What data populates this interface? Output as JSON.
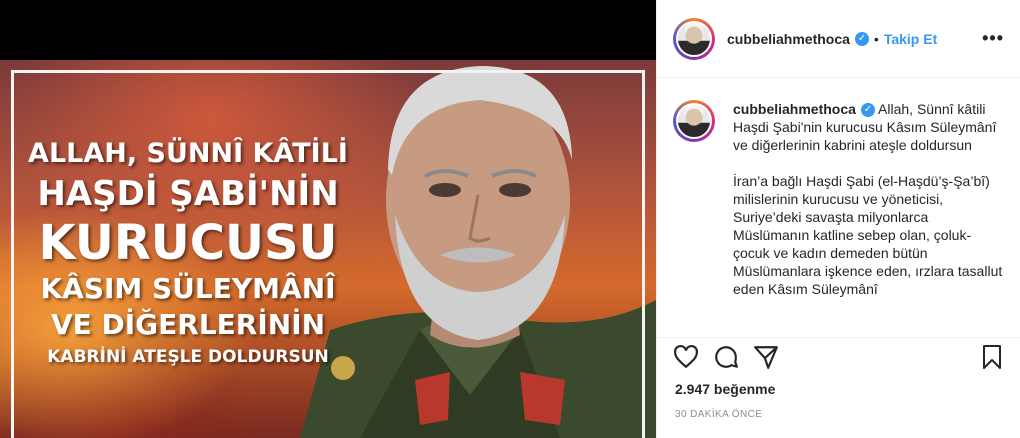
{
  "post": {
    "username": "cubbeliahmethoca",
    "verified_icon": "verified-badge-icon",
    "follow_label": "Takip Et",
    "more_label": "•••",
    "caption_paragraph_1": "Allah, Sünnî kâtili Haşdi Şabi'nin kurucusu Kâsım Süleymânî ve diğerlerinin kabrini ateşle doldursun",
    "caption_paragraph_2": "İran’a bağlı Haşdi Şabi (el-Haşdü’ş-Şa’bî) milislerinin kurucusu ve yöneticisi, Suriye’deki savaşta milyonlarca Müslümanın katline sebep olan, çoluk-çocuk ve kadın demeden bütün Müslümanlara işkence eden, ırzlara tasallut eden Kâsım Süleymânî",
    "likes": "2.947 beğenme",
    "timestamp": "30 DAKİKA ÖNCE"
  },
  "image_text": {
    "line1": "ALLAH, SÜNNÎ KÂTİLİ",
    "line2": "HAŞDİ ŞABİ'NİN",
    "line3": "KURUCUSU",
    "line4": "KÂSIM SÜLEYMÂNÎ",
    "line5": "VE DİĞERLERİNİN",
    "line6": "KABRİNİ ATEŞLE DOLDURSUN"
  },
  "icons": {
    "like": "heart-icon",
    "comment": "comment-icon",
    "share": "paper-plane-icon",
    "save": "bookmark-icon",
    "more": "ellipsis-icon"
  },
  "colors": {
    "link_blue": "#3897f0",
    "text": "#262626",
    "muted": "#8e8e8e"
  }
}
